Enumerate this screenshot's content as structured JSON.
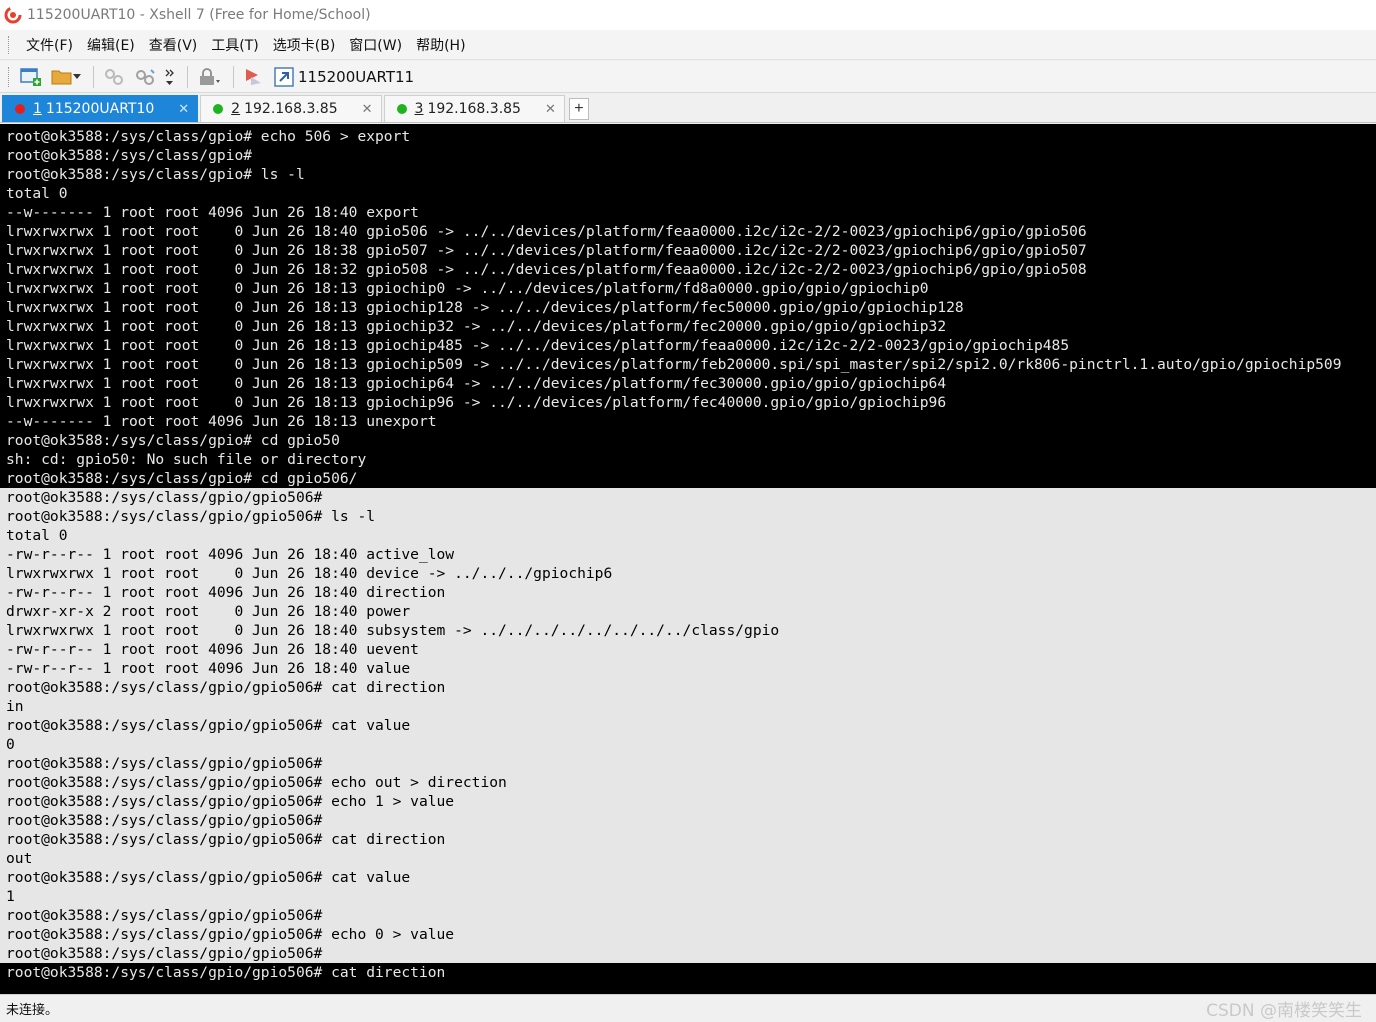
{
  "window": {
    "title": "115200UART10 - Xshell 7 (Free for Home/School)"
  },
  "menu": [
    "文件(F)",
    "编辑(E)",
    "查看(V)",
    "工具(T)",
    "选项卡(B)",
    "窗口(W)",
    "帮助(H)"
  ],
  "toolbar": {
    "session_label": "115200UART11"
  },
  "tabs": [
    {
      "num": "1",
      "label": "115200UART10",
      "status_color": "#e02020",
      "active": true
    },
    {
      "num": "2",
      "label": "192.168.3.85",
      "status_color": "#1fb41f",
      "active": false
    },
    {
      "num": "3",
      "label": "192.168.3.85",
      "status_color": "#1fb41f",
      "active": false
    }
  ],
  "tab_add_label": "+",
  "terminal": {
    "lines": [
      {
        "text": "root@ok3588:/sys/class/gpio# echo 506 > export",
        "selected": false
      },
      {
        "text": "root@ok3588:/sys/class/gpio#",
        "selected": false
      },
      {
        "text": "root@ok3588:/sys/class/gpio# ls -l",
        "selected": false
      },
      {
        "text": "total 0",
        "selected": false
      },
      {
        "text": "--w------- 1 root root 4096 Jun 26 18:40 export",
        "selected": false
      },
      {
        "text": "lrwxrwxrwx 1 root root    0 Jun 26 18:40 gpio506 -> ../../devices/platform/feaa0000.i2c/i2c-2/2-0023/gpiochip6/gpio/gpio506",
        "selected": false
      },
      {
        "text": "lrwxrwxrwx 1 root root    0 Jun 26 18:38 gpio507 -> ../../devices/platform/feaa0000.i2c/i2c-2/2-0023/gpiochip6/gpio/gpio507",
        "selected": false
      },
      {
        "text": "lrwxrwxrwx 1 root root    0 Jun 26 18:32 gpio508 -> ../../devices/platform/feaa0000.i2c/i2c-2/2-0023/gpiochip6/gpio/gpio508",
        "selected": false
      },
      {
        "text": "lrwxrwxrwx 1 root root    0 Jun 26 18:13 gpiochip0 -> ../../devices/platform/fd8a0000.gpio/gpio/gpiochip0",
        "selected": false
      },
      {
        "text": "lrwxrwxrwx 1 root root    0 Jun 26 18:13 gpiochip128 -> ../../devices/platform/fec50000.gpio/gpio/gpiochip128",
        "selected": false
      },
      {
        "text": "lrwxrwxrwx 1 root root    0 Jun 26 18:13 gpiochip32 -> ../../devices/platform/fec20000.gpio/gpio/gpiochip32",
        "selected": false
      },
      {
        "text": "lrwxrwxrwx 1 root root    0 Jun 26 18:13 gpiochip485 -> ../../devices/platform/feaa0000.i2c/i2c-2/2-0023/gpio/gpiochip485",
        "selected": false
      },
      {
        "text": "lrwxrwxrwx 1 root root    0 Jun 26 18:13 gpiochip509 -> ../../devices/platform/feb20000.spi/spi_master/spi2/spi2.0/rk806-pinctrl.1.auto/gpio/gpiochip509",
        "selected": false
      },
      {
        "text": "lrwxrwxrwx 1 root root    0 Jun 26 18:13 gpiochip64 -> ../../devices/platform/fec30000.gpio/gpio/gpiochip64",
        "selected": false
      },
      {
        "text": "lrwxrwxrwx 1 root root    0 Jun 26 18:13 gpiochip96 -> ../../devices/platform/fec40000.gpio/gpio/gpiochip96",
        "selected": false
      },
      {
        "text": "--w------- 1 root root 4096 Jun 26 18:13 unexport",
        "selected": false
      },
      {
        "text": "root@ok3588:/sys/class/gpio# cd gpio50",
        "selected": false
      },
      {
        "text": "sh: cd: gpio50: No such file or directory",
        "selected": false
      },
      {
        "text": "root@ok3588:/sys/class/gpio# cd gpio506/",
        "selected": false
      },
      {
        "text": "root@ok3588:/sys/class/gpio/gpio506#",
        "selected": true
      },
      {
        "text": "root@ok3588:/sys/class/gpio/gpio506# ls -l",
        "selected": true
      },
      {
        "text": "total 0",
        "selected": true
      },
      {
        "text": "-rw-r--r-- 1 root root 4096 Jun 26 18:40 active_low",
        "selected": true
      },
      {
        "text": "lrwxrwxrwx 1 root root    0 Jun 26 18:40 device -> ../../../gpiochip6",
        "selected": true
      },
      {
        "text": "-rw-r--r-- 1 root root 4096 Jun 26 18:40 direction",
        "selected": true
      },
      {
        "text": "drwxr-xr-x 2 root root    0 Jun 26 18:40 power",
        "selected": true
      },
      {
        "text": "lrwxrwxrwx 1 root root    0 Jun 26 18:40 subsystem -> ../../../../../../../../class/gpio",
        "selected": true
      },
      {
        "text": "-rw-r--r-- 1 root root 4096 Jun 26 18:40 uevent",
        "selected": true
      },
      {
        "text": "-rw-r--r-- 1 root root 4096 Jun 26 18:40 value",
        "selected": true
      },
      {
        "text": "root@ok3588:/sys/class/gpio/gpio506# cat direction",
        "selected": true
      },
      {
        "text": "in",
        "selected": true
      },
      {
        "text": "root@ok3588:/sys/class/gpio/gpio506# cat value",
        "selected": true
      },
      {
        "text": "0",
        "selected": true
      },
      {
        "text": "root@ok3588:/sys/class/gpio/gpio506#",
        "selected": true
      },
      {
        "text": "root@ok3588:/sys/class/gpio/gpio506# echo out > direction",
        "selected": true
      },
      {
        "text": "root@ok3588:/sys/class/gpio/gpio506# echo 1 > value",
        "selected": true
      },
      {
        "text": "root@ok3588:/sys/class/gpio/gpio506#",
        "selected": true
      },
      {
        "text": "root@ok3588:/sys/class/gpio/gpio506# cat direction",
        "selected": true
      },
      {
        "text": "out",
        "selected": true
      },
      {
        "text": "root@ok3588:/sys/class/gpio/gpio506# cat value",
        "selected": true
      },
      {
        "text": "1",
        "selected": true
      },
      {
        "text": "root@ok3588:/sys/class/gpio/gpio506#",
        "selected": true
      },
      {
        "text": "root@ok3588:/sys/class/gpio/gpio506# echo 0 > value",
        "selected": true
      },
      {
        "text": "root@ok3588:/sys/class/gpio/gpio506#",
        "selected": true
      },
      {
        "text": "root@ok3588:/sys/class/gpio/gpio506# cat direction",
        "selected": false
      }
    ]
  },
  "status": {
    "text": "未连接。",
    "watermark": "CSDN @南楼笑笑生"
  }
}
